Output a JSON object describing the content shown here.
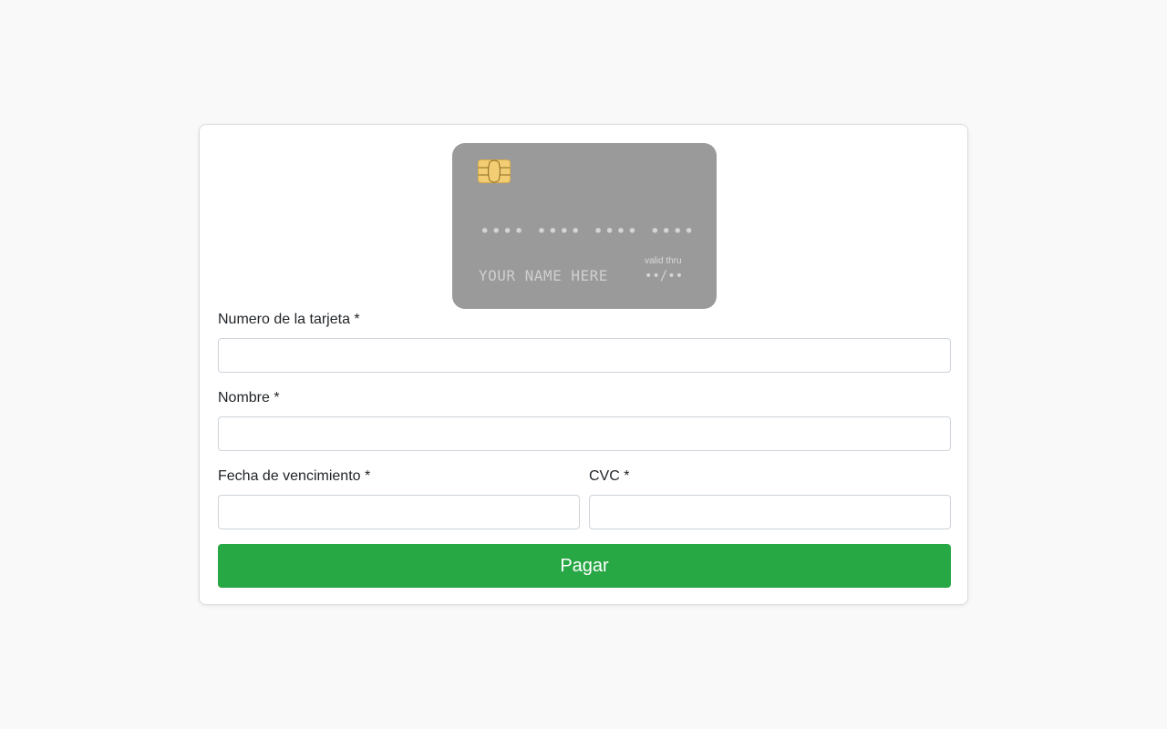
{
  "card_preview": {
    "number_placeholder": "•••• •••• •••• ••••",
    "name_placeholder": "YOUR NAME HERE",
    "valid_thru_label": "valid thru",
    "expiry_placeholder": "••/••",
    "background_color": "#9a9a9a",
    "chip_icon": "card-chip-icon"
  },
  "form": {
    "card_number": {
      "label": "Numero de la tarjeta *",
      "value": ""
    },
    "name": {
      "label": "Nombre *",
      "value": ""
    },
    "expiry": {
      "label": "Fecha de vencimiento *",
      "value": ""
    },
    "cvc": {
      "label": "CVC *",
      "value": ""
    },
    "submit_label": "Pagar",
    "submit_color": "#28a745"
  }
}
